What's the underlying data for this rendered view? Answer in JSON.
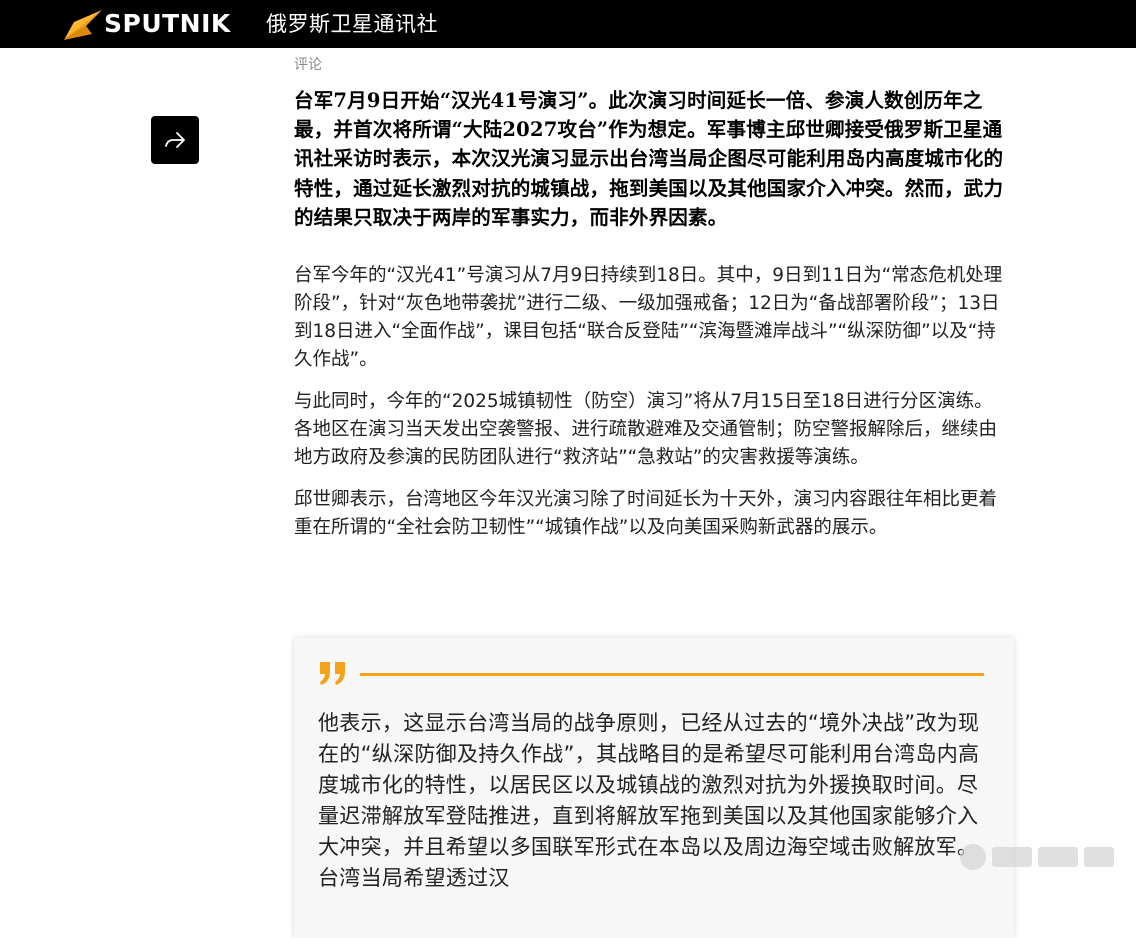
{
  "header": {
    "brand": "SPUTNIK",
    "subtitle": "俄罗斯卫星通讯社",
    "brand_color": "#f5a21b"
  },
  "share": {
    "icon": "share-arrow-icon"
  },
  "article": {
    "category": "评论",
    "lead": "台军7月9日开始“汉光41号演习”。此次演习时间延长一倍、参演人数创历年之最，并首次将所谓“大陆2027攻台”作为想定。军事博主邱世卿接受俄罗斯卫星通讯社采访时表示，本次汉光演习显示出台湾当局企图尽可能利用岛内高度城市化的特性，通过延长激烈对抗的城镇战，拖到美国以及其他国家介入冲突。然而，武力的结果只取决于两岸的军事实力，而非外界因素。",
    "paragraphs": [
      "台军今年的“汉光41”号演习从7月9日持续到18日。其中，9日到11日为“常态危机处理阶段”，针对“灰色地带袭扰”进行二级、一级加强戒备；12日为“备战部署阶段”；13日到18日进入“全面作战”，课目包括“联合反登陆”“滨海暨滩岸战斗”“纵深防御”以及“持久作战”。",
      "与此同时，今年的“2025城镇韧性（防空）演习”将从7月15日至18日进行分区演练。各地区在演习当天发出空袭警报、进行疏散避难及交通管制；防空警报解除后，继续由地方政府及参演的民防团队进行“救济站”“急救站”的灾害救援等演练。",
      "邱世卿表示，台湾地区今年汉光演习除了时间延长为十天外，演习内容跟往年相比更着重在所谓的“全社会防卫韧性”“城镇作战”以及向美国采购新武器的展示。"
    ]
  },
  "quote": {
    "icon": "quote-mark-icon",
    "accent": "#f5a21b",
    "text": "他表示，这显示台湾当局的战争原则，已经从过去的“境外决战”改为现在的“纵深防御及持久作战”，其战略目的是希望尽可能利用台湾岛内高度城市化的特性，以居民区以及城镇战的激烈对抗为外援换取时间。尽量迟滞解放军登陆推进，直到将解放军拖到美国以及其他国家能够介入大冲突，并且希望以多国联军形式在本岛以及周边海空域击败解放军。台湾当局希望透过汉"
  }
}
